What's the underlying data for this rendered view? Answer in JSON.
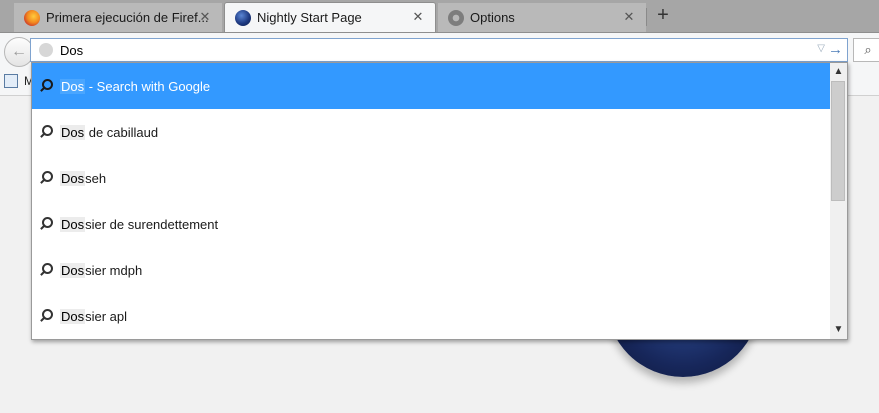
{
  "tabs": [
    {
      "label": "Primera ejecución de Firef...",
      "icon": "firefox-icon",
      "state": "inactive",
      "close": "✕"
    },
    {
      "label": "Nightly Start Page",
      "icon": "nightly-icon",
      "state": "active",
      "close": "✕"
    },
    {
      "label": "Options",
      "icon": "gear-icon",
      "state": "inactive",
      "close": "✕"
    }
  ],
  "toolbar": {
    "new_tab": "+",
    "back": "←",
    "url_value": "Dos",
    "dropmarker": "▽",
    "go": "→",
    "search_icon": "⌕"
  },
  "bookmarks": {
    "first_label": "M"
  },
  "suggestions": [
    {
      "match": "Dos",
      "suffix": " - Search with Google",
      "selected": true
    },
    {
      "match": "Dos",
      "suffix": " de cabillaud",
      "selected": false
    },
    {
      "match": "Dos",
      "suffix": "seh",
      "selected": false
    },
    {
      "match": "Dos",
      "suffix": "sier de surendettement",
      "selected": false
    },
    {
      "match": "Dos",
      "suffix": "sier mdph",
      "selected": false
    },
    {
      "match": "Dos",
      "suffix": "sier apl",
      "selected": false
    }
  ],
  "scrollbar": {
    "up": "▲",
    "down": "▼"
  },
  "colors": {
    "selection": "#3399ff",
    "tabstrip": "#a6a6a6",
    "accent": "#4a7ab6"
  }
}
